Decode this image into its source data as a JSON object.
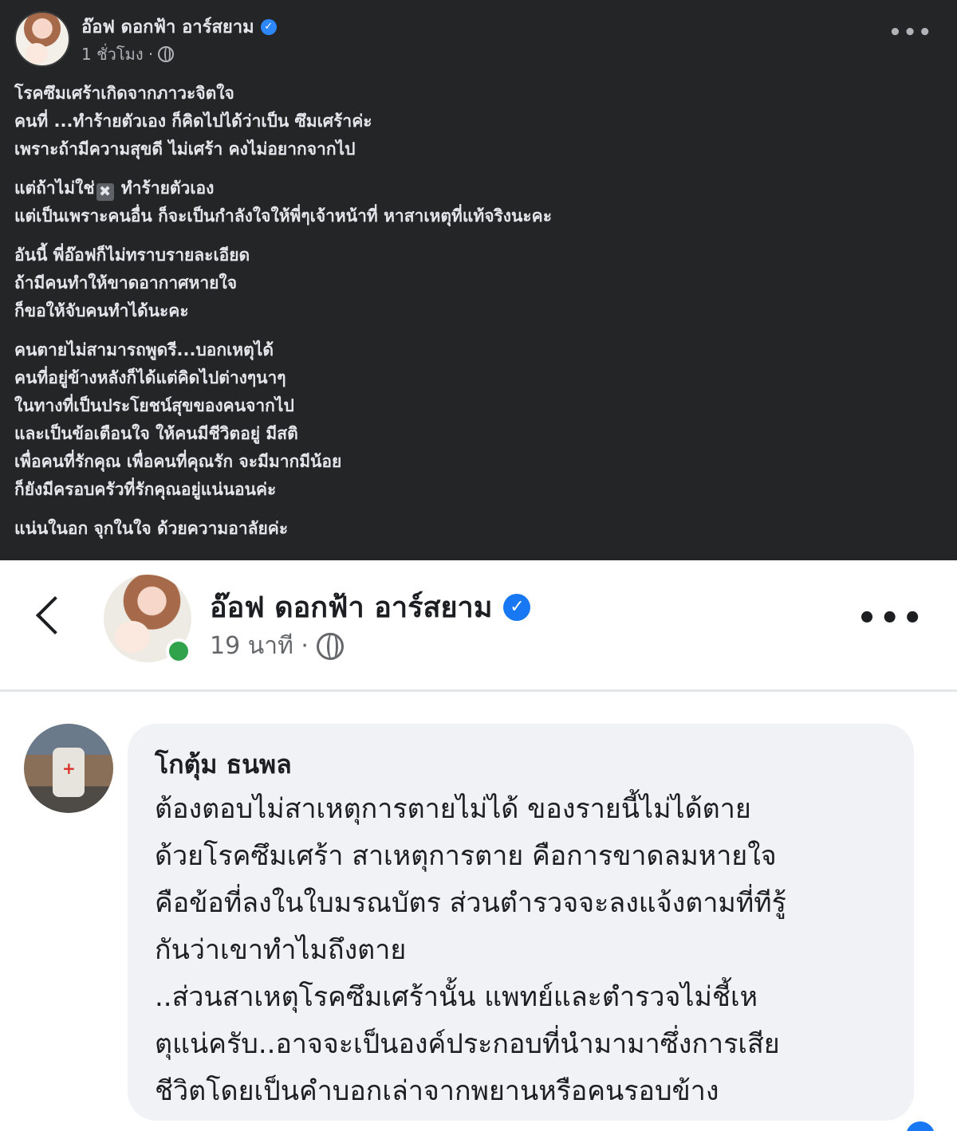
{
  "top_post": {
    "author": "อ๊อฟ ดอกฟ้า อาร์สยาม",
    "time": "1 ชั่วโมง ·",
    "paragraphs": [
      [
        "โรคซึมเศร้าเกิดจากภาวะจิตใจ",
        "คนที่ ...ทำร้ายตัวเอง ก็คิดไปได้ว่าเป็น ซึมเศร้าค่ะ",
        "เพราะถ้ามีความสุขดี ไม่เศร้า คงไม่อยากจากไป"
      ],
      [
        "แต่ถ้าไม่ใช่",
        "ทำร้ายตัวเอง",
        "แต่เป็นเพราะคนอื่น ก็จะเป็นกำลังใจให้พี่ๆเจ้าหน้าที่ หาสาเหตุที่แท้จริงนะคะ"
      ],
      [
        "อันนี้ พี่อ๊อฟก็ไม่ทราบรายละเอียด",
        "ถ้ามีคนทำให้ขาดอากาศหายใจ",
        "ก็ขอให้จับคนทำได้นะคะ"
      ],
      [
        "คนตายไม่สามารถพูดรี...บอกเหตุได้",
        "คนที่อยู่ข้างหลังก็ได้แต่คิดไปต่างๆนาๆ",
        "ในทางที่เป็นประโยชน์สุขของคนจากไป",
        "และเป็นข้อเตือนใจ ให้คนมีชีวิตอยู่ มีสติ",
        "เพื่อคนที่รักคุณ เพื่อคนที่คุณรัก จะมีมากมีน้อย",
        "ก็ยังมีครอบครัวที่รักคุณอยู่แน่นอนค่ะ"
      ],
      [
        "แน่นในอก จุกในใจ ด้วยความอาลัยค่ะ"
      ]
    ],
    "emoji": "✖"
  },
  "bottom_post": {
    "author": "อ๊อฟ ดอกฟ้า อาร์สยาม",
    "time": "19 นาที ·",
    "comment": {
      "author": "โกตุ้ม ธนพล",
      "lines": [
        "ต้องตอบไม่สาเหตุการตายไม่ได้ ของรายนี้ไม่ได้ตาย",
        "ด้วยโรคซึมเศร้า สาเหตุการตาย คือการขาดลมหายใจ",
        "คือข้อที่ลงในใบมรณบัตร ส่วนตำรวจจะลงแจ้งตามที่ทีรู้",
        "กันว่าเขาทำไมถึงตาย",
        "..ส่วนสาเหตุโรคซึมเศร้านั้น แพทย์และตำรวจไม่ชี้เห",
        "ตุแน่ครับ..อาจจะเป็นองค์ประกอบที่นำมามาซึ่งการเสีย",
        "ชีวิตโดยเป็นคำบอกเล่าจากพยานหรือคนรอบข้าง"
      ]
    }
  },
  "icons": {
    "verified": "✓",
    "more": "•••"
  },
  "colors": {
    "dark_bg": "#242526",
    "verified_blue": "#1877f2",
    "online_green": "#31a24c",
    "bubble_bg": "#f0f2f5"
  }
}
